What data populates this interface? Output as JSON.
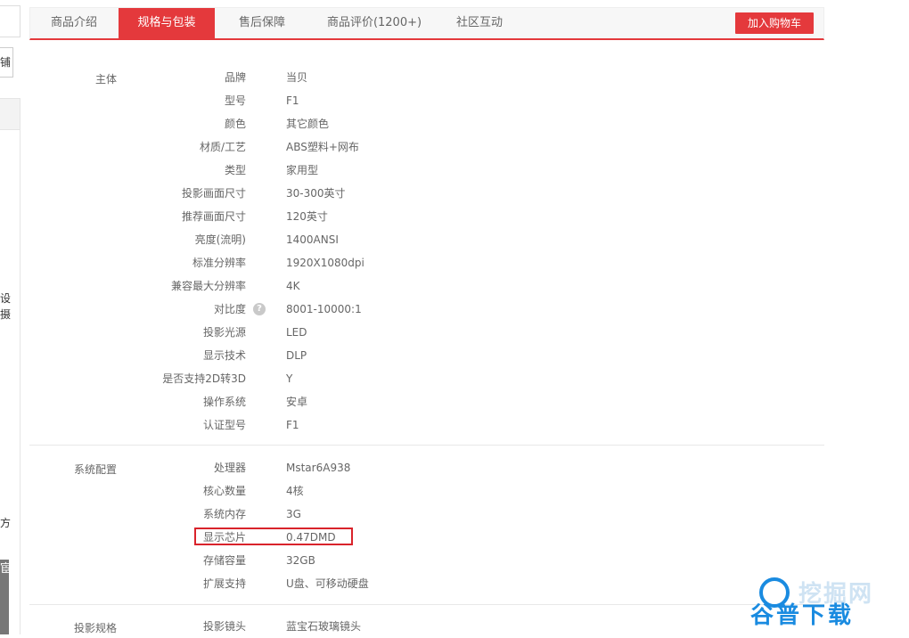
{
  "left_strip": {
    "button_fragment": "铺",
    "text_fragments": [
      "设",
      "摄",
      "方"
    ],
    "dark_label_fragment": "宦"
  },
  "tabs": [
    {
      "label": "商品介绍",
      "active": false
    },
    {
      "label": "规格与包装",
      "active": true
    },
    {
      "label": "售后保障",
      "active": false
    },
    {
      "label": "商品评价(1200+)",
      "active": false
    },
    {
      "label": "社区互动",
      "active": false
    }
  ],
  "cart_button": "加入购物车",
  "sections": [
    {
      "title": "主体",
      "rows": [
        {
          "key": "品牌",
          "value": "当贝"
        },
        {
          "key": "型号",
          "value": "F1"
        },
        {
          "key": "颜色",
          "value": "其它颜色"
        },
        {
          "key": "材质/工艺",
          "value": "ABS塑料+网布"
        },
        {
          "key": "类型",
          "value": "家用型"
        },
        {
          "key": "投影画面尺寸",
          "value": "30-300英寸"
        },
        {
          "key": "推荐画面尺寸",
          "value": "120英寸"
        },
        {
          "key": "亮度(流明)",
          "value": "1400ANSI"
        },
        {
          "key": "标准分辨率",
          "value": "1920X1080dpi"
        },
        {
          "key": "兼容最大分辨率",
          "value": "4K"
        },
        {
          "key": "对比度",
          "value": "8001-10000:1",
          "help": "?"
        },
        {
          "key": "投影光源",
          "value": "LED"
        },
        {
          "key": "显示技术",
          "value": "DLP"
        },
        {
          "key": "是否支持2D转3D",
          "value": "Y"
        },
        {
          "key": "操作系统",
          "value": "安卓"
        },
        {
          "key": "认证型号",
          "value": "F1"
        }
      ]
    },
    {
      "title": "系统配置",
      "rows": [
        {
          "key": "处理器",
          "value": "Mstar6A938"
        },
        {
          "key": "核心数量",
          "value": "4核"
        },
        {
          "key": "系统内存",
          "value": "3G"
        },
        {
          "key": "显示芯片",
          "value": "0.47DMD",
          "highlighted": true
        },
        {
          "key": "存储容量",
          "value": "32GB"
        },
        {
          "key": "扩展支持",
          "value": "U盘、可移动硬盘"
        }
      ]
    },
    {
      "title": "投影规格",
      "rows": [
        {
          "key": "投影镜头",
          "value": "蓝宝石玻璃镜头"
        }
      ]
    }
  ],
  "watermark": {
    "top_text": "挖掘网",
    "main_text": "谷普下载"
  },
  "colors": {
    "accent": "#e4393c",
    "highlight_border": "#d9232b",
    "watermark_blue": "#1a8be0"
  }
}
